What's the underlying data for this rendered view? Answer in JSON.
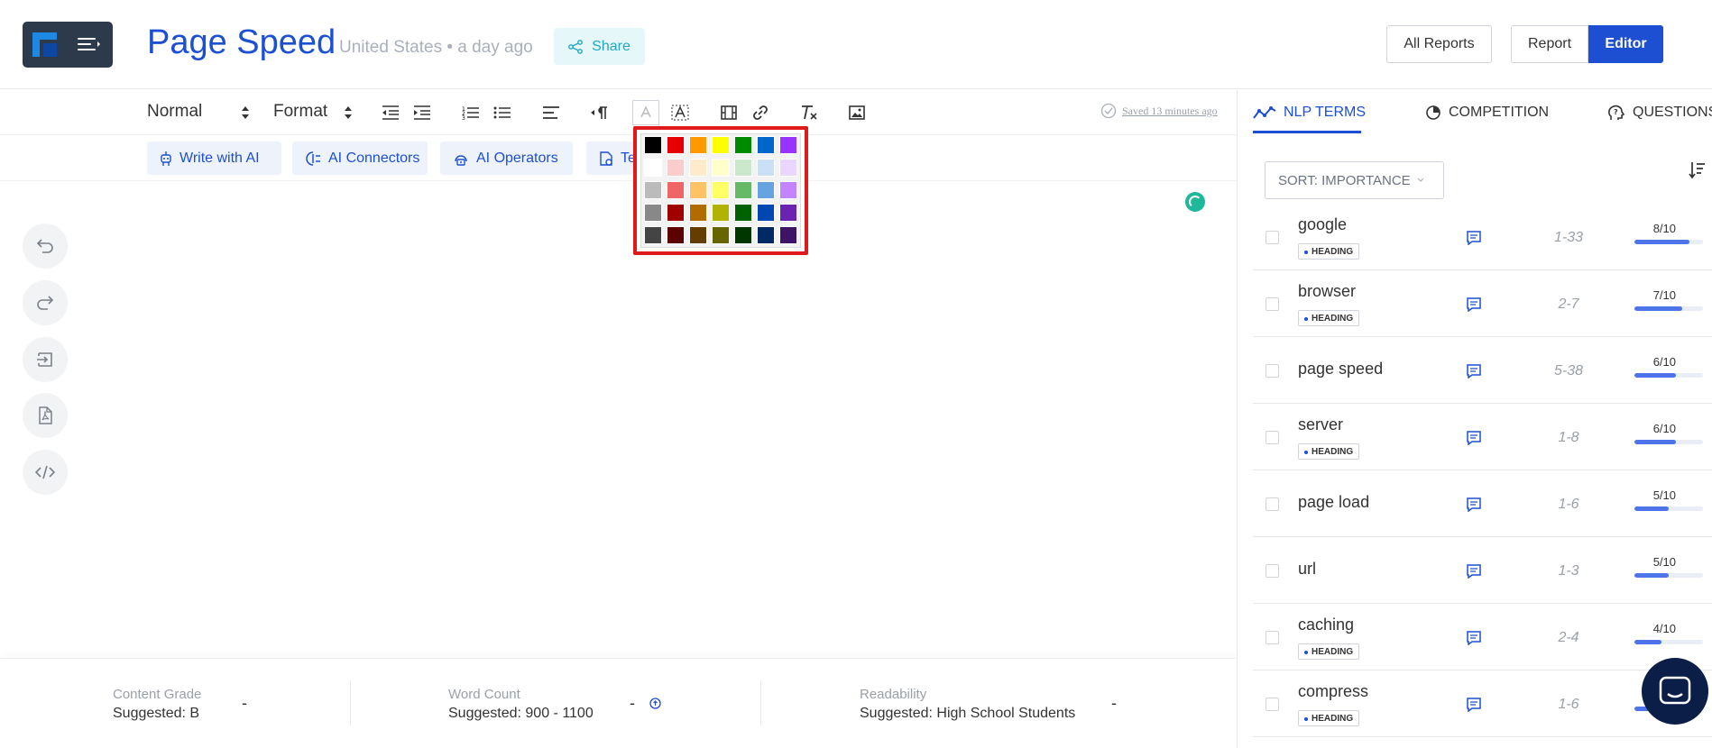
{
  "header": {
    "title": "Page Speed",
    "meta": "United States • a day ago",
    "share_label": "Share",
    "all_reports_label": "All Reports",
    "report_label": "Report",
    "editor_label": "Editor"
  },
  "toolbar": {
    "paragraph_style": "Normal",
    "format_label": "Format",
    "saved_text": "Saved 13 minutes ago"
  },
  "ai_buttons": {
    "write_with_ai": "Write with AI",
    "ai_connectors": "AI Connectors",
    "ai_operators": "AI Operators",
    "templates_partial": "Te"
  },
  "palette": {
    "rows": [
      [
        "#000000",
        "#e60000",
        "#ff9900",
        "#ffff00",
        "#008a00",
        "#0066cc",
        "#9933ff"
      ],
      [
        "#ffffff",
        "#facccc",
        "#ffebcc",
        "#ffffcc",
        "#cce8cc",
        "#cce0f5",
        "#ebd6ff"
      ],
      [
        "#bbbbbb",
        "#f06666",
        "#ffc266",
        "#ffff66",
        "#66b966",
        "#66a3e0",
        "#c285ff"
      ],
      [
        "#888888",
        "#a10000",
        "#b26b00",
        "#b2b200",
        "#006100",
        "#0047b2",
        "#6b24b2"
      ],
      [
        "#444444",
        "#5c0000",
        "#663d00",
        "#666600",
        "#003700",
        "#002966",
        "#3d1466"
      ]
    ]
  },
  "stats": {
    "content_grade": {
      "label": "Content Grade",
      "suggested": "Suggested: B",
      "value": "-"
    },
    "word_count": {
      "label": "Word Count",
      "suggested": "Suggested: 900 - 1100",
      "value": "-"
    },
    "readability": {
      "label": "Readability",
      "suggested": "Suggested: High School Students",
      "value": "-"
    }
  },
  "sidebar": {
    "tabs": [
      {
        "label": "NLP TERMS",
        "icon": "trend-line-icon",
        "active": true
      },
      {
        "label": "COMPETITION",
        "icon": "pie-chart-icon",
        "active": false
      },
      {
        "label": "QUESTIONS",
        "icon": "question-head-icon",
        "active": false
      }
    ],
    "sort_label": "SORT: IMPORTANCE",
    "terms": [
      {
        "name": "google",
        "badge": "HEADING",
        "range": "1-33",
        "score": "8/10",
        "fill": 0.8
      },
      {
        "name": "browser",
        "badge": "HEADING",
        "range": "2-7",
        "score": "7/10",
        "fill": 0.7
      },
      {
        "name": "page speed",
        "badge": "",
        "range": "5-38",
        "score": "6/10",
        "fill": 0.6
      },
      {
        "name": "server",
        "badge": "HEADING",
        "range": "1-8",
        "score": "6/10",
        "fill": 0.6
      },
      {
        "name": "page load",
        "badge": "",
        "range": "1-6",
        "score": "5/10",
        "fill": 0.5
      },
      {
        "name": "url",
        "badge": "",
        "range": "1-3",
        "score": "5/10",
        "fill": 0.5
      },
      {
        "name": "caching",
        "badge": "HEADING",
        "range": "2-4",
        "score": "4/10",
        "fill": 0.4
      },
      {
        "name": "compress",
        "badge": "HEADING",
        "range": "1-6",
        "score": "",
        "fill": 0.4
      }
    ]
  },
  "colors": {
    "brand_blue": "#1c4fd1",
    "share_cyan": "#21a8c8",
    "highlight_red": "#e01a1a",
    "spinner_green": "#1fb89a",
    "chat_navy": "#0b1e48"
  }
}
